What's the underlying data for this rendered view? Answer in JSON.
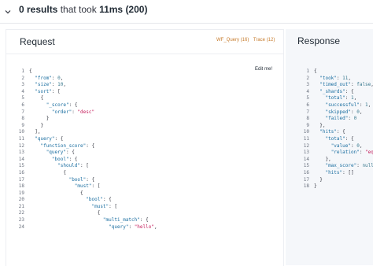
{
  "header": {
    "count": "0 results",
    "mid": " that took ",
    "took": "11ms",
    "status": "(200)"
  },
  "request": {
    "title": "Request",
    "links": [
      "WF_Query (16)",
      "Trace (12)"
    ],
    "edit_label": "Edit me!",
    "lines": [
      {
        "n": "1",
        "i": 0,
        "t": [
          [
            "p",
            "{"
          ]
        ]
      },
      {
        "n": "2",
        "i": 1,
        "t": [
          [
            "k",
            "\"from\""
          ],
          [
            "p",
            ": "
          ],
          [
            "n",
            "0"
          ],
          [
            "p",
            ","
          ]
        ]
      },
      {
        "n": "3",
        "i": 1,
        "t": [
          [
            "k",
            "\"size\""
          ],
          [
            "p",
            ": "
          ],
          [
            "n",
            "10"
          ],
          [
            "p",
            ","
          ]
        ]
      },
      {
        "n": "4",
        "i": 1,
        "t": [
          [
            "k",
            "\"sort\""
          ],
          [
            "p",
            ": ["
          ]
        ]
      },
      {
        "n": "5",
        "i": 2,
        "t": [
          [
            "p",
            "{"
          ]
        ]
      },
      {
        "n": "6",
        "i": 3,
        "t": [
          [
            "k",
            "\"_score\""
          ],
          [
            "p",
            ": {"
          ]
        ]
      },
      {
        "n": "7",
        "i": 4,
        "t": [
          [
            "k",
            "\"order\""
          ],
          [
            "p",
            ": "
          ],
          [
            "s",
            "\"desc\""
          ]
        ]
      },
      {
        "n": "8",
        "i": 3,
        "t": [
          [
            "p",
            "}"
          ]
        ]
      },
      {
        "n": "9",
        "i": 2,
        "t": [
          [
            "p",
            "}"
          ]
        ]
      },
      {
        "n": "10",
        "i": 1,
        "t": [
          [
            "p",
            "],"
          ]
        ]
      },
      {
        "n": "11",
        "i": 1,
        "t": [
          [
            "k",
            "\"query\""
          ],
          [
            "p",
            ": {"
          ]
        ]
      },
      {
        "n": "12",
        "i": 2,
        "t": [
          [
            "k",
            "\"function_score\""
          ],
          [
            "p",
            ": {"
          ]
        ]
      },
      {
        "n": "13",
        "i": 3,
        "t": [
          [
            "k",
            "\"query\""
          ],
          [
            "p",
            ": {"
          ]
        ]
      },
      {
        "n": "14",
        "i": 4,
        "t": [
          [
            "k",
            "\"bool\""
          ],
          [
            "p",
            ": {"
          ]
        ]
      },
      {
        "n": "15",
        "i": 5,
        "t": [
          [
            "k",
            "\"should\""
          ],
          [
            "p",
            ": ["
          ]
        ]
      },
      {
        "n": "16",
        "i": 6,
        "t": [
          [
            "p",
            "{"
          ]
        ]
      },
      {
        "n": "17",
        "i": 7,
        "t": [
          [
            "k",
            "\"bool\""
          ],
          [
            "p",
            ": {"
          ]
        ]
      },
      {
        "n": "18",
        "i": 8,
        "t": [
          [
            "k",
            "\"must\""
          ],
          [
            "p",
            ": ["
          ]
        ]
      },
      {
        "n": "19",
        "i": 9,
        "t": [
          [
            "p",
            "{"
          ]
        ]
      },
      {
        "n": "20",
        "i": 10,
        "t": [
          [
            "k",
            "\"bool\""
          ],
          [
            "p",
            ": {"
          ]
        ]
      },
      {
        "n": "21",
        "i": 11,
        "t": [
          [
            "k",
            "\"must\""
          ],
          [
            "p",
            ": ["
          ]
        ]
      },
      {
        "n": "22",
        "i": 12,
        "t": [
          [
            "p",
            "{"
          ]
        ]
      },
      {
        "n": "23",
        "i": 13,
        "t": [
          [
            "k",
            "\"multi_match\""
          ],
          [
            "p",
            ": {"
          ]
        ]
      },
      {
        "n": "24",
        "i": 14,
        "t": [
          [
            "k",
            "\"query\""
          ],
          [
            "p",
            ": "
          ],
          [
            "s",
            "\"hello\""
          ],
          [
            "p",
            ","
          ]
        ]
      }
    ]
  },
  "response": {
    "title": "Response",
    "lines": [
      {
        "n": "1",
        "i": 0,
        "t": [
          [
            "p",
            "{"
          ]
        ]
      },
      {
        "n": "2",
        "i": 1,
        "t": [
          [
            "k",
            "\"took\""
          ],
          [
            "p",
            ": "
          ],
          [
            "n",
            "11"
          ],
          [
            "p",
            ","
          ]
        ]
      },
      {
        "n": "3",
        "i": 1,
        "t": [
          [
            "k",
            "\"timed_out\""
          ],
          [
            "p",
            ": "
          ],
          [
            "n",
            "false"
          ],
          [
            "p",
            ","
          ]
        ]
      },
      {
        "n": "4",
        "i": 1,
        "t": [
          [
            "k",
            "\"_shards\""
          ],
          [
            "p",
            ": {"
          ]
        ]
      },
      {
        "n": "5",
        "i": 2,
        "t": [
          [
            "k",
            "\"total\""
          ],
          [
            "p",
            ": "
          ],
          [
            "n",
            "1"
          ],
          [
            "p",
            ","
          ]
        ]
      },
      {
        "n": "6",
        "i": 2,
        "t": [
          [
            "k",
            "\"successful\""
          ],
          [
            "p",
            ": "
          ],
          [
            "n",
            "1"
          ],
          [
            "p",
            ","
          ]
        ]
      },
      {
        "n": "7",
        "i": 2,
        "t": [
          [
            "k",
            "\"skipped\""
          ],
          [
            "p",
            ": "
          ],
          [
            "n",
            "0"
          ],
          [
            "p",
            ","
          ]
        ]
      },
      {
        "n": "8",
        "i": 2,
        "t": [
          [
            "k",
            "\"failed\""
          ],
          [
            "p",
            ": "
          ],
          [
            "n",
            "0"
          ]
        ]
      },
      {
        "n": "9",
        "i": 1,
        "t": [
          [
            "p",
            "},"
          ]
        ]
      },
      {
        "n": "10",
        "i": 1,
        "t": [
          [
            "k",
            "\"hits\""
          ],
          [
            "p",
            ": {"
          ]
        ]
      },
      {
        "n": "11",
        "i": 2,
        "t": [
          [
            "k",
            "\"total\""
          ],
          [
            "p",
            ": {"
          ]
        ]
      },
      {
        "n": "12",
        "i": 3,
        "t": [
          [
            "k",
            "\"value\""
          ],
          [
            "p",
            ": "
          ],
          [
            "n",
            "0"
          ],
          [
            "p",
            ","
          ]
        ]
      },
      {
        "n": "13",
        "i": 3,
        "t": [
          [
            "k",
            "\"relation\""
          ],
          [
            "p",
            ": "
          ],
          [
            "s",
            "\"eq\""
          ]
        ]
      },
      {
        "n": "14",
        "i": 2,
        "t": [
          [
            "p",
            "},"
          ]
        ]
      },
      {
        "n": "15",
        "i": 2,
        "t": [
          [
            "k",
            "\"max_score\""
          ],
          [
            "p",
            ": "
          ],
          [
            "n",
            "null"
          ],
          [
            "p",
            ","
          ]
        ]
      },
      {
        "n": "16",
        "i": 2,
        "t": [
          [
            "k",
            "\"hits\""
          ],
          [
            "p",
            ": []"
          ]
        ]
      },
      {
        "n": "17",
        "i": 1,
        "t": [
          [
            "p",
            "}"
          ]
        ]
      },
      {
        "n": "18",
        "i": 0,
        "t": [
          [
            "p",
            "}"
          ]
        ]
      }
    ]
  },
  "colors": {
    "key": "#1a6ea0",
    "string": "#c51d5b",
    "number": "#3b7a8f",
    "link": "#c67a2a",
    "response_bg": "#f5f7fa"
  },
  "icons": {
    "collapse": "chevron-down-icon"
  }
}
